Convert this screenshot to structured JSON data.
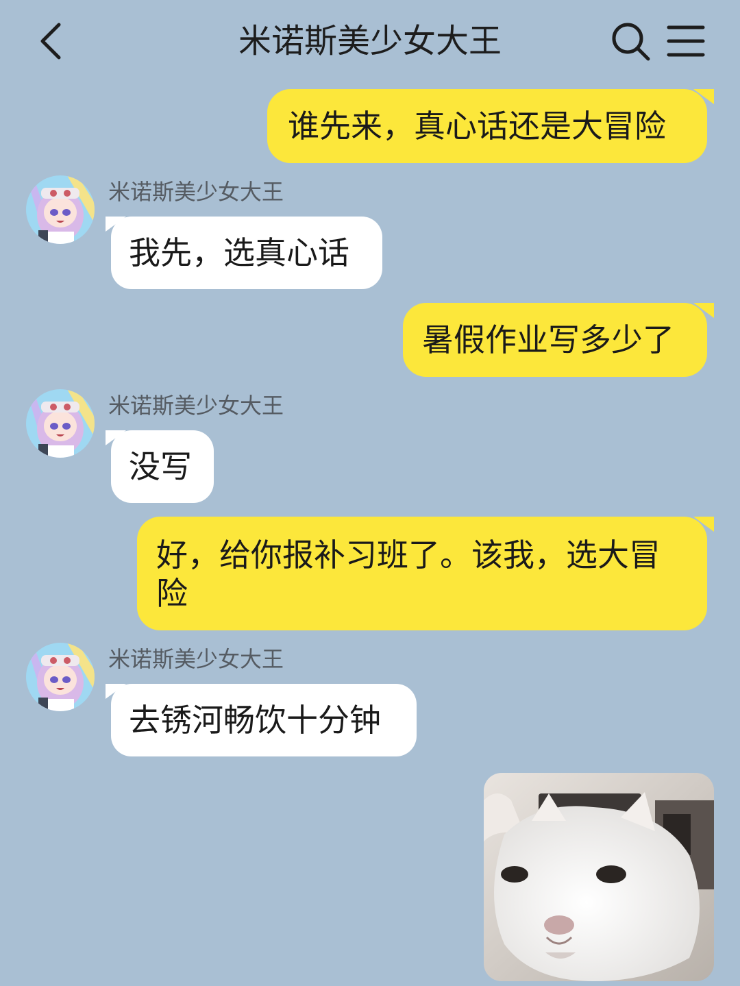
{
  "header": {
    "title": "米诺斯美少女大王",
    "back_icon": "chevron-left-icon",
    "search_icon": "search-icon",
    "menu_icon": "menu-icon"
  },
  "messages": [
    {
      "direction": "outgoing",
      "text": "谁先来，真心话还是大冒险"
    },
    {
      "direction": "incoming",
      "sender": "米诺斯美少女大王",
      "text": "我先，选真心话"
    },
    {
      "direction": "outgoing",
      "text": "暑假作业写多少了"
    },
    {
      "direction": "incoming",
      "sender": "米诺斯美少女大王",
      "text": "没写"
    },
    {
      "direction": "outgoing",
      "text": "好，给你报补习班了。该我，选大冒险"
    },
    {
      "direction": "incoming",
      "sender": "米诺斯美少女大王",
      "text": "去锈河畅饮十分钟"
    },
    {
      "direction": "outgoing",
      "type": "sticker",
      "image": "white-cat-sticker"
    }
  ],
  "colors": {
    "background": "#a9bfd3",
    "outgoing_bubble": "#fce73b",
    "incoming_bubble": "#ffffff"
  }
}
